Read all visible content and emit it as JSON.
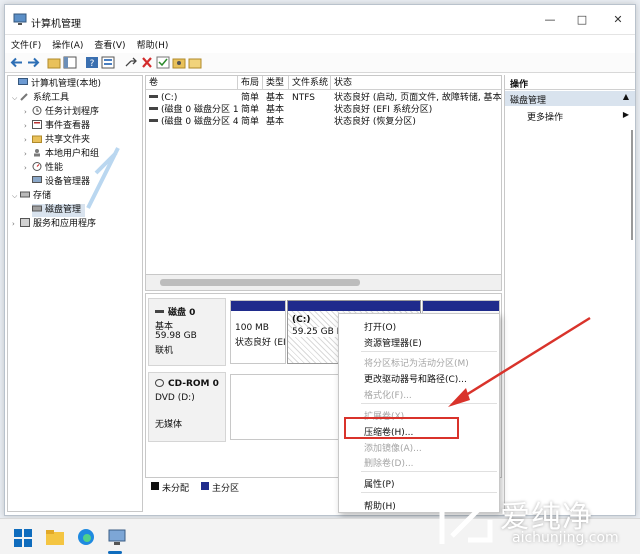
{
  "window": {
    "title": "计算机管理"
  },
  "controls": {
    "minimize": "—",
    "maximize": "□",
    "close": "✕"
  },
  "menu": [
    "文件(F)",
    "操作(A)",
    "查看(V)",
    "帮助(H)"
  ],
  "tree": {
    "root": "计算机管理(本地)",
    "system_tools": "系统工具",
    "task_scheduler": "任务计划程序",
    "event_viewer": "事件查看器",
    "shared_folders": "共享文件夹",
    "local_users": "本地用户和组",
    "performance": "性能",
    "device_manager": "设备管理器",
    "storage": "存储",
    "disk_management": "磁盘管理",
    "services": "服务和应用程序"
  },
  "volumes": {
    "headers": [
      "卷",
      "布局",
      "类型",
      "文件系统",
      "状态"
    ],
    "rows": [
      [
        "(C:)",
        "简单",
        "基本",
        "NTFS",
        "状态良好 (启动, 页面文件, 故障转储, 基本数据"
      ],
      [
        "(磁盘 0 磁盘分区 1)",
        "简单",
        "基本",
        "",
        "状态良好 (EFI 系统分区)"
      ],
      [
        "(磁盘 0 磁盘分区 4)",
        "简单",
        "基本",
        "",
        "状态良好 (恢复分区)"
      ]
    ]
  },
  "disks": {
    "disk0": {
      "name": "磁盘 0",
      "type": "基本",
      "size": "59.98 GB",
      "status": "联机"
    },
    "part1": {
      "size": "100 MB",
      "status": "状态良好 (EI"
    },
    "part2": {
      "name": "(C:)",
      "size": "59.25 GB NT"
    },
    "cdrom": {
      "name": "CD-ROM 0",
      "type": "DVD (D:)",
      "status": "无媒体"
    }
  },
  "legend": {
    "unallocated": "未分配",
    "primary": "主分区"
  },
  "actions": {
    "header": "操作",
    "section": "磁盘管理",
    "more": "更多操作"
  },
  "context_menu": {
    "open": "打开(O)",
    "explorer": "资源管理器(E)",
    "mark_active": "将分区标记为活动分区(M)",
    "change_letter": "更改驱动器号和路径(C)...",
    "format": "格式化(F)...",
    "extend": "扩展卷(X)...",
    "shrink": "压缩卷(H)...",
    "add_mirror": "添加镜像(A)...",
    "delete": "删除卷(D)...",
    "properties": "属性(P)",
    "help": "帮助(H)"
  },
  "watermark": {
    "brand": "爱纯净",
    "url": "aichunjing.com"
  },
  "colors": {
    "primary_partition": "#1f2b8c",
    "accent": "#d9332b",
    "selection": "#d9e3ee"
  }
}
